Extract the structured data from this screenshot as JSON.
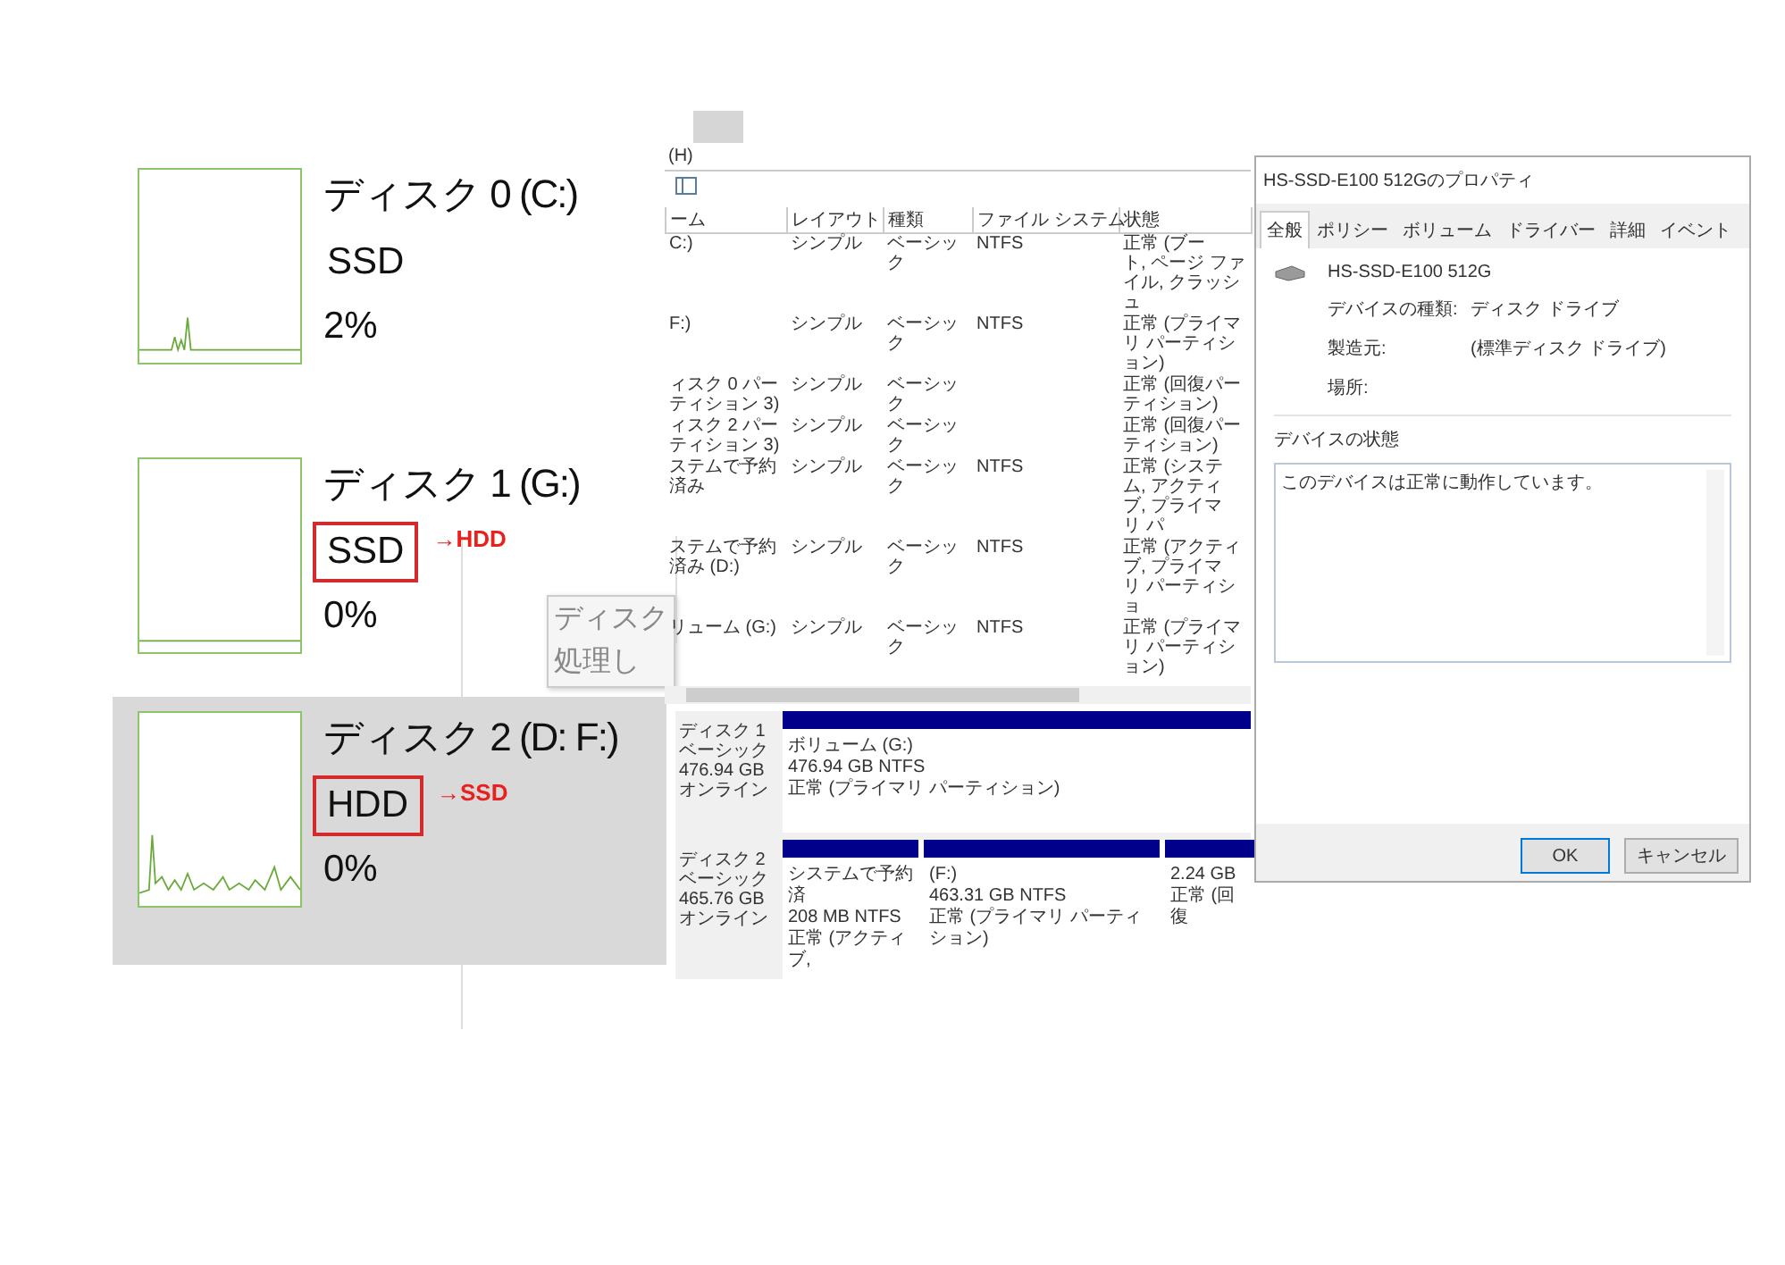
{
  "disk_list": [
    {
      "title": "ディスク 0 (C:)",
      "type": "SSD",
      "usage": "2%",
      "selected": false,
      "marked": false
    },
    {
      "title": "ディスク 1 (G:)",
      "type": "SSD",
      "usage": "0%",
      "selected": false,
      "marked": true,
      "annotation": "→HDD"
    },
    {
      "title": "ディスク 2 (D: F:)",
      "type": "HDD",
      "usage": "0%",
      "selected": true,
      "marked": true,
      "annotation": "→SSD"
    }
  ],
  "tooltip": {
    "lines": [
      "ディスク",
      "処理し"
    ]
  },
  "volume_window": {
    "menu": "(H)",
    "columns": [
      "ーム",
      "レイアウト",
      "種類",
      "ファイル システム",
      "状態"
    ],
    "rows": [
      {
        "name": "C:)",
        "layout": "シンプル",
        "type": "ベーシック",
        "fs": "NTFS",
        "status": "正常 (ブート, ページ ファイル, クラッシュ"
      },
      {
        "name": "F:)",
        "layout": "シンプル",
        "type": "ベーシック",
        "fs": "NTFS",
        "status": "正常 (プライマリ パーティション)"
      },
      {
        "name": "ィスク 0 パーティション 3)",
        "layout": "シンプル",
        "type": "ベーシック",
        "status": "正常 (回復パーティション)"
      },
      {
        "name": "ィスク 2 パーティション 3)",
        "layout": "シンプル",
        "type": "ベーシック",
        "status": "正常 (回復パーティション)"
      },
      {
        "name": "ステムで予約済み",
        "layout": "シンプル",
        "type": "ベーシック",
        "fs": "NTFS",
        "status": "正常 (システム, アクティブ, プライマリ パ"
      },
      {
        "name": "ステムで予約済み (D:)",
        "layout": "シンプル",
        "type": "ベーシック",
        "fs": "NTFS",
        "status": "正常 (アクティブ, プライマリ パーティショ"
      },
      {
        "name": "リューム (G:)",
        "layout": "シンプル",
        "type": "ベーシック",
        "fs": "NTFS",
        "status": "正常 (プライマリ パーティション)"
      }
    ]
  },
  "disk_map": {
    "disks": [
      {
        "name": "ディスク 1",
        "type": "ベーシック",
        "size": "476.94 GB",
        "status": "オンライン",
        "partitions": [
          {
            "lines": [
              "ボリューム (G:)",
              "476.94 GB NTFS",
              "正常 (プライマリ パーティション)"
            ]
          }
        ]
      },
      {
        "name": "ディスク 2",
        "type": "ベーシック",
        "size": "465.76 GB",
        "status": "オンライン",
        "partitions": [
          {
            "lines": [
              "システムで予約済",
              "208 MB NTFS",
              "正常 (アクティブ, "
            ]
          },
          {
            "lines": [
              "(F:)",
              "463.31 GB NTFS",
              "正常 (プライマリ パーティション)"
            ]
          },
          {
            "lines": [
              "2.24 GB",
              "正常 (回復"
            ]
          }
        ]
      }
    ]
  },
  "properties": {
    "title": "HS-SSD-E100 512Gのプロパティ",
    "tabs": [
      {
        "label": "全般",
        "selected": true
      },
      {
        "label": "ポリシー",
        "selected": false
      },
      {
        "label": "ボリューム",
        "selected": false
      },
      {
        "label": "ドライバー",
        "selected": false
      },
      {
        "label": "詳細",
        "selected": false
      },
      {
        "label": "イベント",
        "selected": false
      }
    ],
    "device_name": "HS-SSD-E100 512G",
    "fields": [
      {
        "label": "デバイスの種類:",
        "value": "ディスク ドライブ"
      },
      {
        "label": "製造元:",
        "value": "(標準ディスク ドライブ)"
      },
      {
        "label": "場所:"
      }
    ],
    "status_group": "デバイスの状態",
    "status_text": "このデバイスは正常に動作しています。",
    "buttons": [
      "OK",
      "キャンセル"
    ]
  }
}
